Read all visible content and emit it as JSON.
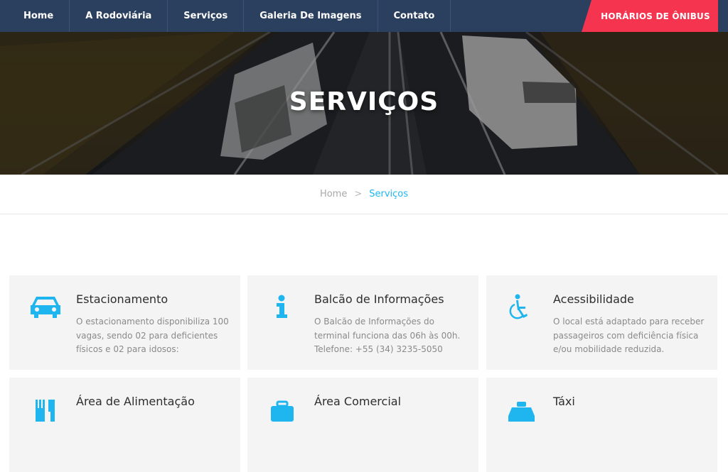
{
  "nav": {
    "items": [
      "Home",
      "A Rodoviária",
      "Serviços",
      "Galeria De Imagens",
      "Contato"
    ],
    "cta_label": "HORÁRIOS DE ÔNIBUS"
  },
  "hero": {
    "title": "SERVIÇOS"
  },
  "breadcrumb": {
    "home": "Home",
    "separator": ">",
    "current": "Serviços"
  },
  "colors": {
    "nav_bg": "#2b3f5f",
    "cta_bg": "#f5344f",
    "accent": "#1fb6f0",
    "card_bg": "#f4f4f4"
  },
  "services": [
    {
      "icon": "car-icon",
      "title": "Estacionamento",
      "description": "O estacionamento disponibiliza 100 vagas, sendo 02 para deficientes físicos e 02 para idosos:"
    },
    {
      "icon": "info-icon",
      "title": "Balcão de Informações",
      "description": "O Balcão de Informações do terminal funciona das 06h às 00h. Telefone: +55 (34) 3235-5050"
    },
    {
      "icon": "wheelchair-icon",
      "title": "Acessibilidade",
      "description": "O local está adaptado para receber passageiros com deficiência física e/ou mobilidade reduzida."
    },
    {
      "icon": "food-icon",
      "title": "Área de Alimentação",
      "description": ""
    },
    {
      "icon": "briefcase-icon",
      "title": "Área Comercial",
      "description": ""
    },
    {
      "icon": "taxi-icon",
      "title": "Táxi",
      "description": ""
    }
  ]
}
